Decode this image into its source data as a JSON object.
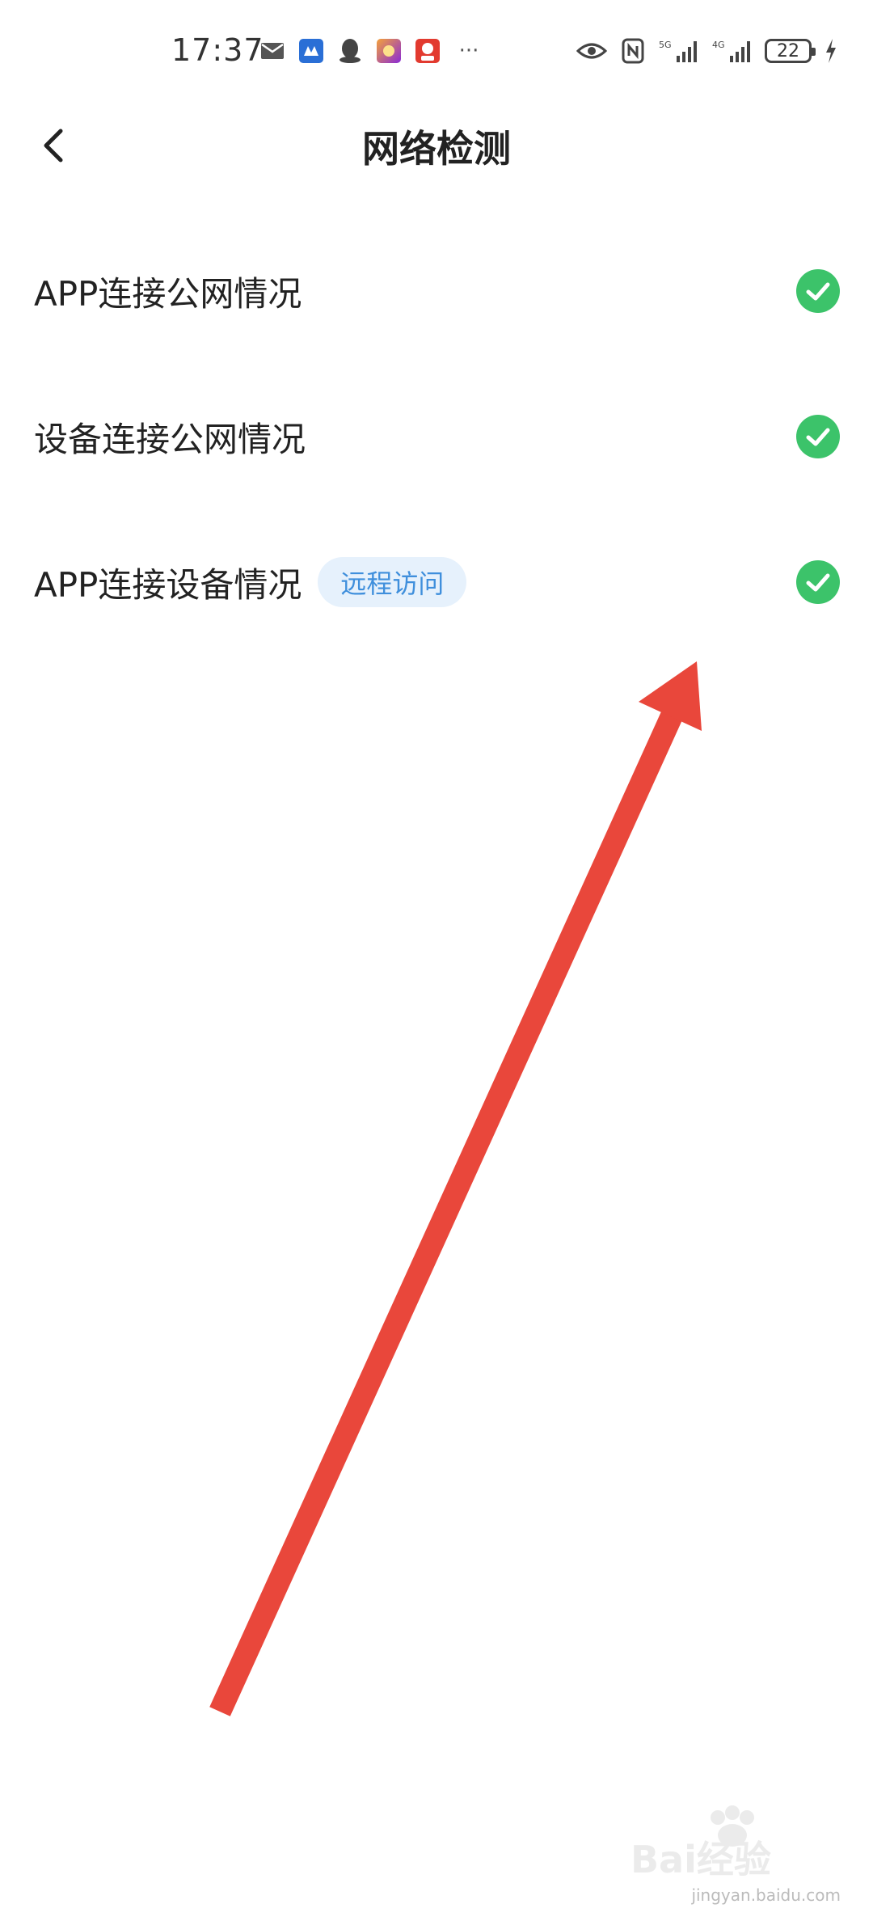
{
  "status_bar": {
    "time": "17:37",
    "more_indicator": "···",
    "battery_level": "22",
    "left_icons": [
      "mail-icon",
      "app-notification-icon",
      "qq-icon",
      "game-icon",
      "shopping-618-icon"
    ],
    "right_icons": [
      "eye-icon",
      "nfc-icon",
      "signal-5g-icon",
      "signal-4g-icon",
      "battery-icon",
      "charging-icon"
    ]
  },
  "header": {
    "title": "网络检测"
  },
  "checks": [
    {
      "label": "APP连接公网情况",
      "status": "ok"
    },
    {
      "label": "设备连接公网情况",
      "status": "ok"
    },
    {
      "label": "APP连接设备情况",
      "status": "ok",
      "tag": "远程访问"
    }
  ],
  "colors": {
    "check_green": "#3cc36a",
    "tag_bg": "#e6f1fc",
    "tag_text": "#3f8fdc",
    "arrow_red": "#e9473b"
  },
  "watermark": {
    "text": "Bai经验",
    "url_text": "jingyan.baidu.com"
  }
}
